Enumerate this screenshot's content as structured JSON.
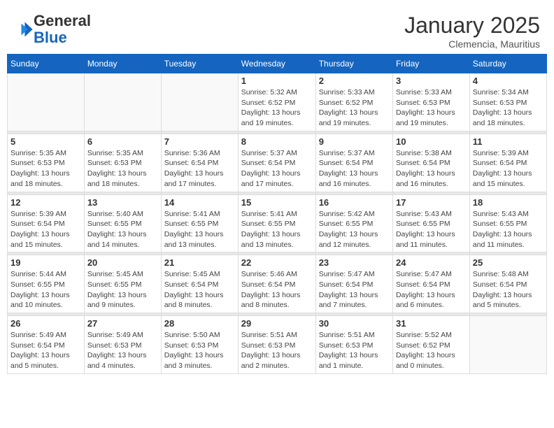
{
  "logo": {
    "general": "General",
    "blue": "Blue"
  },
  "title": "January 2025",
  "location": "Clemencia, Mauritius",
  "weekdays": [
    "Sunday",
    "Monday",
    "Tuesday",
    "Wednesday",
    "Thursday",
    "Friday",
    "Saturday"
  ],
  "weeks": [
    [
      {
        "day": "",
        "info": ""
      },
      {
        "day": "",
        "info": ""
      },
      {
        "day": "",
        "info": ""
      },
      {
        "day": "1",
        "info": "Sunrise: 5:32 AM\nSunset: 6:52 PM\nDaylight: 13 hours\nand 19 minutes."
      },
      {
        "day": "2",
        "info": "Sunrise: 5:33 AM\nSunset: 6:52 PM\nDaylight: 13 hours\nand 19 minutes."
      },
      {
        "day": "3",
        "info": "Sunrise: 5:33 AM\nSunset: 6:53 PM\nDaylight: 13 hours\nand 19 minutes."
      },
      {
        "day": "4",
        "info": "Sunrise: 5:34 AM\nSunset: 6:53 PM\nDaylight: 13 hours\nand 18 minutes."
      }
    ],
    [
      {
        "day": "5",
        "info": "Sunrise: 5:35 AM\nSunset: 6:53 PM\nDaylight: 13 hours\nand 18 minutes."
      },
      {
        "day": "6",
        "info": "Sunrise: 5:35 AM\nSunset: 6:53 PM\nDaylight: 13 hours\nand 18 minutes."
      },
      {
        "day": "7",
        "info": "Sunrise: 5:36 AM\nSunset: 6:54 PM\nDaylight: 13 hours\nand 17 minutes."
      },
      {
        "day": "8",
        "info": "Sunrise: 5:37 AM\nSunset: 6:54 PM\nDaylight: 13 hours\nand 17 minutes."
      },
      {
        "day": "9",
        "info": "Sunrise: 5:37 AM\nSunset: 6:54 PM\nDaylight: 13 hours\nand 16 minutes."
      },
      {
        "day": "10",
        "info": "Sunrise: 5:38 AM\nSunset: 6:54 PM\nDaylight: 13 hours\nand 16 minutes."
      },
      {
        "day": "11",
        "info": "Sunrise: 5:39 AM\nSunset: 6:54 PM\nDaylight: 13 hours\nand 15 minutes."
      }
    ],
    [
      {
        "day": "12",
        "info": "Sunrise: 5:39 AM\nSunset: 6:54 PM\nDaylight: 13 hours\nand 15 minutes."
      },
      {
        "day": "13",
        "info": "Sunrise: 5:40 AM\nSunset: 6:55 PM\nDaylight: 13 hours\nand 14 minutes."
      },
      {
        "day": "14",
        "info": "Sunrise: 5:41 AM\nSunset: 6:55 PM\nDaylight: 13 hours\nand 13 minutes."
      },
      {
        "day": "15",
        "info": "Sunrise: 5:41 AM\nSunset: 6:55 PM\nDaylight: 13 hours\nand 13 minutes."
      },
      {
        "day": "16",
        "info": "Sunrise: 5:42 AM\nSunset: 6:55 PM\nDaylight: 13 hours\nand 12 minutes."
      },
      {
        "day": "17",
        "info": "Sunrise: 5:43 AM\nSunset: 6:55 PM\nDaylight: 13 hours\nand 11 minutes."
      },
      {
        "day": "18",
        "info": "Sunrise: 5:43 AM\nSunset: 6:55 PM\nDaylight: 13 hours\nand 11 minutes."
      }
    ],
    [
      {
        "day": "19",
        "info": "Sunrise: 5:44 AM\nSunset: 6:55 PM\nDaylight: 13 hours\nand 10 minutes."
      },
      {
        "day": "20",
        "info": "Sunrise: 5:45 AM\nSunset: 6:55 PM\nDaylight: 13 hours\nand 9 minutes."
      },
      {
        "day": "21",
        "info": "Sunrise: 5:45 AM\nSunset: 6:54 PM\nDaylight: 13 hours\nand 8 minutes."
      },
      {
        "day": "22",
        "info": "Sunrise: 5:46 AM\nSunset: 6:54 PM\nDaylight: 13 hours\nand 8 minutes."
      },
      {
        "day": "23",
        "info": "Sunrise: 5:47 AM\nSunset: 6:54 PM\nDaylight: 13 hours\nand 7 minutes."
      },
      {
        "day": "24",
        "info": "Sunrise: 5:47 AM\nSunset: 6:54 PM\nDaylight: 13 hours\nand 6 minutes."
      },
      {
        "day": "25",
        "info": "Sunrise: 5:48 AM\nSunset: 6:54 PM\nDaylight: 13 hours\nand 5 minutes."
      }
    ],
    [
      {
        "day": "26",
        "info": "Sunrise: 5:49 AM\nSunset: 6:54 PM\nDaylight: 13 hours\nand 5 minutes."
      },
      {
        "day": "27",
        "info": "Sunrise: 5:49 AM\nSunset: 6:53 PM\nDaylight: 13 hours\nand 4 minutes."
      },
      {
        "day": "28",
        "info": "Sunrise: 5:50 AM\nSunset: 6:53 PM\nDaylight: 13 hours\nand 3 minutes."
      },
      {
        "day": "29",
        "info": "Sunrise: 5:51 AM\nSunset: 6:53 PM\nDaylight: 13 hours\nand 2 minutes."
      },
      {
        "day": "30",
        "info": "Sunrise: 5:51 AM\nSunset: 6:53 PM\nDaylight: 13 hours\nand 1 minute."
      },
      {
        "day": "31",
        "info": "Sunrise: 5:52 AM\nSunset: 6:52 PM\nDaylight: 13 hours\nand 0 minutes."
      },
      {
        "day": "",
        "info": ""
      }
    ]
  ]
}
